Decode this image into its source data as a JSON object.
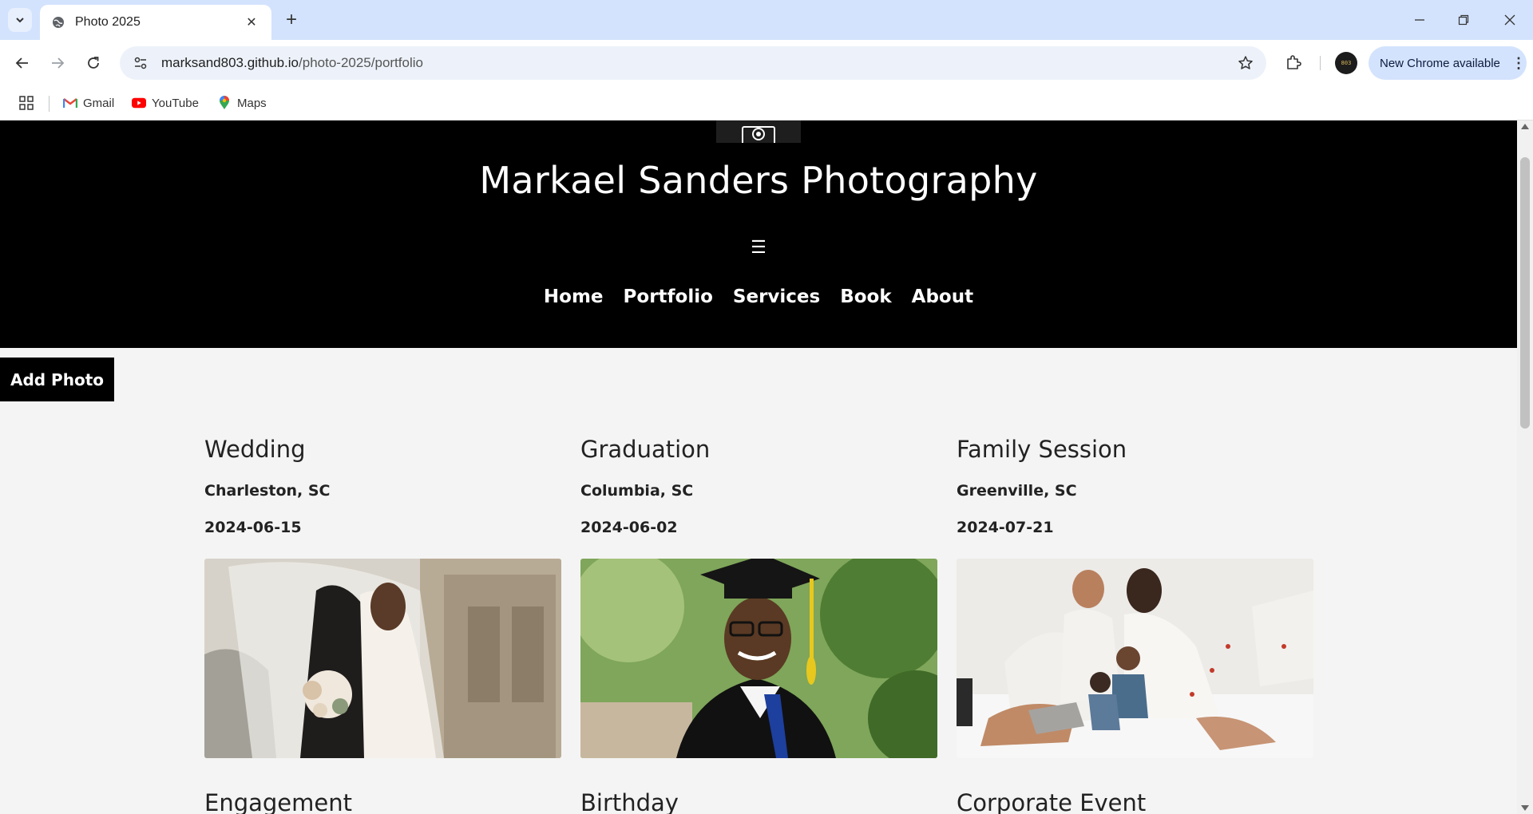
{
  "browser": {
    "tab_title": "Photo 2025",
    "url_host": "marksand803.github.io",
    "url_path": "/photo-2025/portfolio",
    "update_label": "New Chrome available",
    "profile_initials": "803",
    "bookmarks": [
      {
        "label": "Gmail",
        "icon": "gmail-icon"
      },
      {
        "label": "YouTube",
        "icon": "youtube-icon"
      },
      {
        "label": "Maps",
        "icon": "maps-icon"
      }
    ]
  },
  "site": {
    "title": "Markael Sanders Photography",
    "menu_icon": "☰",
    "nav": [
      "Home",
      "Portfolio",
      "Services",
      "Book",
      "About"
    ],
    "add_photo_label": "Add Photo"
  },
  "portfolio": [
    {
      "title": "Wedding",
      "location": "Charleston, SC",
      "date": "2024-06-15",
      "image": "wedding-photo"
    },
    {
      "title": "Graduation",
      "location": "Columbia, SC",
      "date": "2024-06-02",
      "image": "graduation-photo"
    },
    {
      "title": "Family Session",
      "location": "Greenville, SC",
      "date": "2024-07-21",
      "image": "family-photo"
    },
    {
      "title": "Engagement"
    },
    {
      "title": "Birthday"
    },
    {
      "title": "Corporate Event"
    }
  ]
}
